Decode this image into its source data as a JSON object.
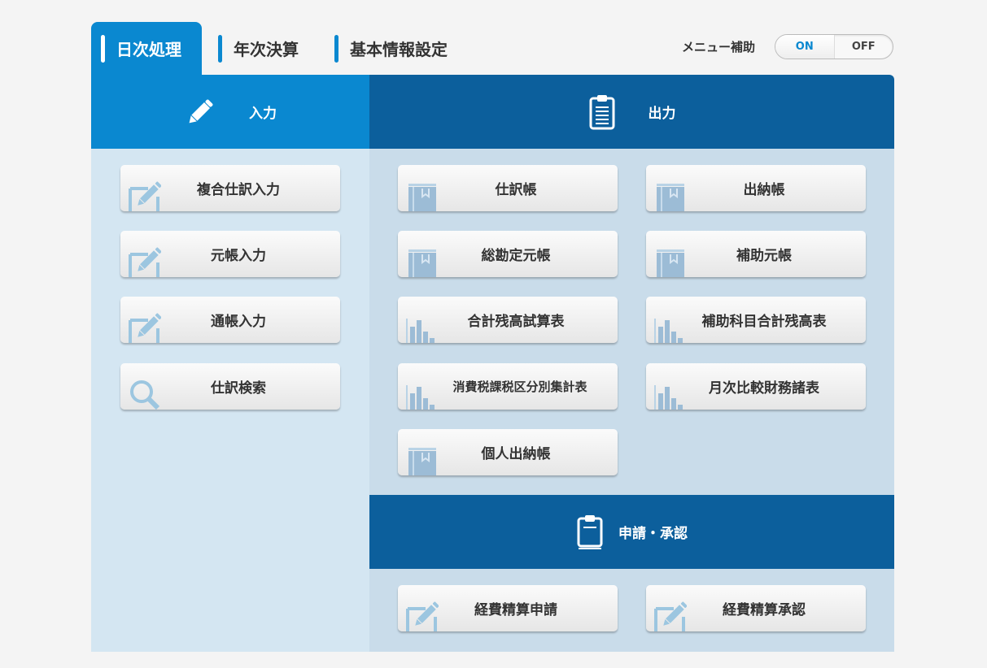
{
  "tabs": [
    {
      "label": "日次処理",
      "active": true
    },
    {
      "label": "年次決算"
    },
    {
      "label": "基本情報設定"
    }
  ],
  "menu_assist": {
    "label": "メニュー補助",
    "on": "ON",
    "off": "OFF",
    "selected": "ON"
  },
  "input": {
    "title": "入力",
    "icon": "pencil-icon",
    "buttons": [
      "複合仕訳入力",
      "元帳入力",
      "通帳入力",
      "仕訳検索"
    ]
  },
  "output": {
    "title": "出力",
    "icon": "clipboard-icon",
    "buttons": [
      "仕訳帳",
      "出納帳",
      "総勘定元帳",
      "補助元帳",
      "合計残高試算表",
      "補助科目合計残高表",
      "消費税課税区分別集計表",
      "月次比較財務諸表",
      "個人出納帳"
    ]
  },
  "approval": {
    "title": "申請・承認",
    "icon": "clipboard-icon",
    "buttons": [
      "経費精算申請",
      "経費精算承認"
    ]
  },
  "colors": {
    "input_header": "#0a88d0",
    "output_header": "#0c5f9c",
    "input_bg": "#d4e6f2",
    "output_bg": "#c9dcea"
  }
}
